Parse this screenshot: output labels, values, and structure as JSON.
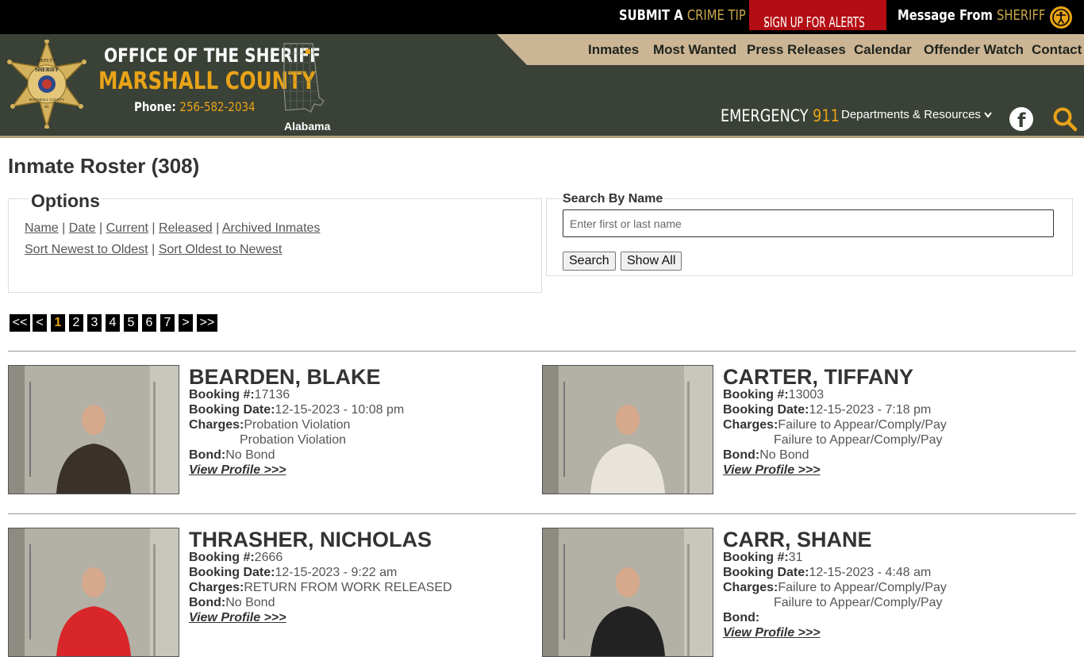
{
  "topbar": {
    "tip_prefix": "SUBMIT A",
    "tip_suffix": "CRIME TIP",
    "alerts": "SIGN UP FOR ALERTS",
    "msg_prefix": "Message From",
    "msg_suffix": "SHERIFF",
    "chevron": "›"
  },
  "header": {
    "office": "OFFICE OF THE SHERIFF",
    "county": "MARSHALL COUNTY",
    "phone_label": "Phone:",
    "phone": "256-582-2034",
    "state": "Alabama",
    "badge_text": [
      "DEPUTY",
      "SHERIFF",
      "MARSHALL COUNTY",
      "AL"
    ],
    "nav": [
      "Inmates",
      "Most Wanted",
      "Press Releases",
      "Calendar",
      "Offender Watch",
      "Contact"
    ],
    "emergency_label": "EMERGENCY",
    "emergency_num": "911",
    "departments": "Departments & Resources"
  },
  "icons": {
    "accessibility": "accessibility-icon",
    "facebook": "facebook-icon",
    "search": "search-icon",
    "chevron_down": "chevron-down-icon"
  },
  "colors": {
    "gold": "#e8a317",
    "header_green": "#3a4136",
    "nav_tan": "#cbb595",
    "alert_red": "#b40e14"
  },
  "page": {
    "title": "Inmate Roster (308)"
  },
  "options": {
    "legend": "Options",
    "sort_links": [
      "Name",
      "Date",
      "Current",
      "Released",
      "Archived Inmates"
    ],
    "order_links": [
      "Sort Newest to Oldest",
      "Sort Oldest to Newest"
    ],
    "sep": "|"
  },
  "search": {
    "label": "Search By Name",
    "placeholder": "Enter first or last name",
    "value": "",
    "search_btn": "Search",
    "show_all_btn": "Show All"
  },
  "pagination": [
    "<<",
    "<",
    "1",
    "2",
    "3",
    "4",
    "5",
    "6",
    "7",
    ">",
    ">>"
  ],
  "pagination_current": "1",
  "labels": {
    "booking_no": "Booking #:",
    "booking_date": "Booking Date:",
    "charges": "Charges:",
    "bond": "Bond:",
    "view_profile": "View Profile >>>"
  },
  "inmates": [
    {
      "name": "BEARDEN, BLAKE",
      "booking": "17136",
      "date": "12-15-2023 - 10:08 pm",
      "charges": [
        "Probation Violation",
        "Probation Violation"
      ],
      "bond": "No Bond",
      "shirt": "#3a3128"
    },
    {
      "name": "CARTER, TIFFANY",
      "booking": "13003",
      "date": "12-15-2023 - 7:18 pm",
      "charges": [
        "Failure to Appear/Comply/Pay",
        "Failure to Appear/Comply/Pay"
      ],
      "bond": "No Bond",
      "shirt": "#e9e4da"
    },
    {
      "name": "THRASHER, NICHOLAS",
      "booking": "2666",
      "date": "12-15-2023 - 9:22 am",
      "charges": [
        "RETURN FROM WORK RELEASED"
      ],
      "bond": "No Bond",
      "shirt": "#d8262a"
    },
    {
      "name": "CARR, SHANE",
      "booking": "31",
      "date": "12-15-2023 - 4:48 am",
      "charges": [
        "Failure to Appear/Comply/Pay",
        "Failure to Appear/Comply/Pay"
      ],
      "bond": "",
      "shirt": "#222222"
    }
  ]
}
